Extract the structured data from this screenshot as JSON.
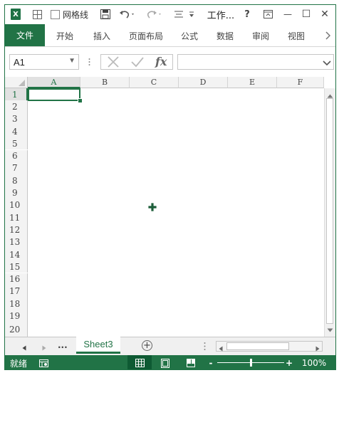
{
  "titlebar": {
    "logo_letter": "X",
    "gridlines_label": "网格线",
    "title": "工作...",
    "help": "?",
    "minimize": "—",
    "maximize": "☐",
    "close": "✕"
  },
  "ribbon": {
    "file_tab": "文件",
    "tabs": [
      "开始",
      "插入",
      "页面布局",
      "公式",
      "数据",
      "审阅",
      "视图"
    ]
  },
  "formula_bar": {
    "name_box": "A1",
    "formula": ""
  },
  "grid": {
    "columns": [
      "A",
      "B",
      "C",
      "D",
      "E",
      "F"
    ],
    "rows": [
      "1",
      "2",
      "3",
      "4",
      "5",
      "6",
      "7",
      "8",
      "9",
      "10",
      "11",
      "12",
      "13",
      "14",
      "15",
      "16",
      "17",
      "18",
      "19",
      "20"
    ],
    "selected_cell": "A1"
  },
  "sheets": {
    "more": "...",
    "active": "Sheet3",
    "add": "+"
  },
  "status": {
    "ready": "就绪",
    "zoom_minus": "-",
    "zoom_plus": "+",
    "zoom": "100%",
    "zoom_level_fraction": 0.5
  },
  "colors": {
    "accent": "#217346"
  }
}
